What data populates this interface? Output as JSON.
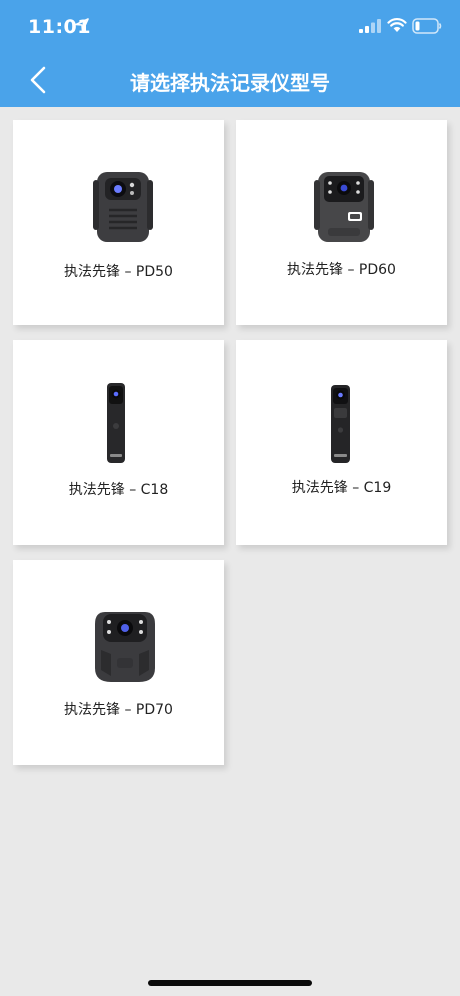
{
  "status_bar": {
    "time": "11:01"
  },
  "header": {
    "title": "请选择执法记录仪型号"
  },
  "models": [
    {
      "label": "执法先锋 – PD50",
      "icon": "body-camera-pd50-icon"
    },
    {
      "label": "执法先锋 – PD60",
      "icon": "body-camera-pd60-icon"
    },
    {
      "label": "执法先锋 – C18",
      "icon": "body-camera-c18-icon"
    },
    {
      "label": "执法先锋 – C19",
      "icon": "body-camera-c19-icon"
    },
    {
      "label": "执法先锋 – PD70",
      "icon": "body-camera-pd70-icon"
    }
  ],
  "colors": {
    "header": "#4aa3ea",
    "background": "#e9e9e9",
    "card": "#ffffff"
  }
}
